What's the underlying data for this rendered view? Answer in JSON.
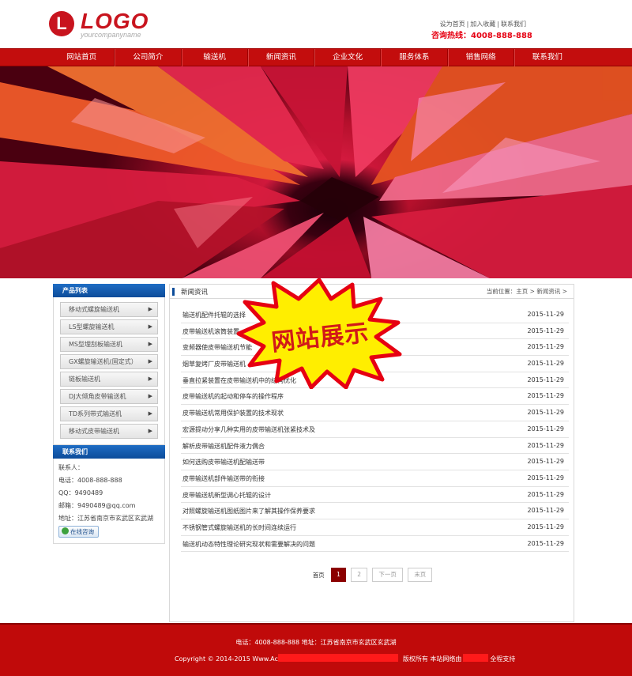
{
  "header": {
    "logo_letter": "L",
    "logo_text": "LOGO",
    "logo_sub": "yourcompanyname",
    "top_links": [
      "设为首页",
      "加入收藏",
      "联系我们"
    ],
    "separator": "|",
    "hotline": "咨询热线：4008-888-888"
  },
  "nav": [
    "网站首页",
    "公司简介",
    "输送机",
    "新闻资讯",
    "企业文化",
    "服务体系",
    "销售网络",
    "联系我们"
  ],
  "sidebar": {
    "product_title": "产品列表",
    "products": [
      "移动式螺旋输送机",
      "LS型螺旋输送机",
      "MS型埋刮板输送机",
      "GX螺旋输送机(固定式）",
      "链板输送机",
      "DJ大倾角皮带输送机",
      "TD系列带式输送机",
      "移动式皮带输送机"
    ],
    "arrow": "▶",
    "contact_title": "联系我们",
    "contact_lines": [
      "联系人：",
      "电话：4008-888-888",
      "QQ：9490489",
      "邮箱：9490489@qq.com",
      "地址：江苏省南京市玄武区玄武湖"
    ],
    "online_label": "在线咨询"
  },
  "main": {
    "title": "新闻资讯",
    "breadcrumb": "当前位置：主页 > 新闻资讯 >",
    "news": [
      {
        "title": "输送机配件托辊的选择",
        "date": "2015-11-29"
      },
      {
        "title": "皮带输送机滚筒装置",
        "date": "2015-11-29"
      },
      {
        "title": "变频器使皮带输送机节能",
        "date": "2015-11-29"
      },
      {
        "title": "烟草复烤厂皮带输送机",
        "date": "2015-11-29"
      },
      {
        "title": "垂直拉紧装置在皮带输送机中的结构优化",
        "date": "2015-11-29"
      },
      {
        "title": "皮带输送机的起动和停车的操作程序",
        "date": "2015-11-29"
      },
      {
        "title": "皮带输送机常用保护装置的技术现状",
        "date": "2015-11-29"
      },
      {
        "title": "宏源提动分享几种实用的皮带输送机张紧技术及",
        "date": "2015-11-29"
      },
      {
        "title": "解析皮带输送机配件液力偶合",
        "date": "2015-11-29"
      },
      {
        "title": "如何选购皮带输送机配输送带",
        "date": "2015-11-29"
      },
      {
        "title": "皮带输送机部件输送带的衔接",
        "date": "2015-11-29"
      },
      {
        "title": "皮带输送机新型调心托辊的设计",
        "date": "2015-11-29"
      },
      {
        "title": "对照螺旋输送机图纸图片来了解其操作保养要求",
        "date": "2015-11-29"
      },
      {
        "title": "不锈钢管式螺旋输送机的长时间连续运行",
        "date": "2015-11-29"
      },
      {
        "title": "输送机动态特性理论研究现状和需要解决的问题",
        "date": "2015-11-29"
      }
    ],
    "pager": {
      "first": "首页",
      "current": "1",
      "page2": "2",
      "next": "下一页",
      "last": "末页"
    }
  },
  "overlay": {
    "text": "网站展示"
  },
  "footer": {
    "line1": "电话：4008-888-888 地址：江苏省南京市玄武区玄武湖",
    "line2_a": "Copyright © 2014-2015 Www.Ac",
    "line2_b": "版权所有 本站网络由",
    "line2_c": "全程支持"
  },
  "colors": {
    "brand_red": "#c30d0d",
    "side_blue": "#0c4c9a",
    "hotline": "#e60012"
  }
}
